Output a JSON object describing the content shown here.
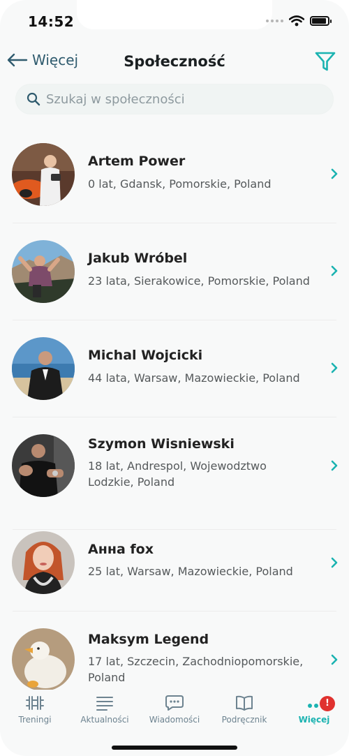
{
  "status_bar": {
    "time": "14:52"
  },
  "nav": {
    "back_label": "Więcej",
    "title": "Społeczność"
  },
  "search": {
    "placeholder": "Szukaj w społeczności",
    "value": ""
  },
  "colors": {
    "accent": "#1bb3b1",
    "badge": "#e0322f",
    "nav_text": "#2f5b6e"
  },
  "members": [
    {
      "name": "Artem Power",
      "meta": "0 lat, Gdansk, Pomorskie, Poland"
    },
    {
      "name": "Jakub Wróbel",
      "meta": "23 lata, Sierakowice, Pomorskie, Poland"
    },
    {
      "name": "Michal Wojcicki",
      "meta": "44 lata, Warsaw, Mazowieckie, Poland"
    },
    {
      "name": "Szymon Wisniewski",
      "meta": "18 lat, Andrespol, Wojewodztwo Lodzkie, Poland"
    },
    {
      "name": "Анна fox",
      "meta": "25 lat, Warsaw, Mazowieckie, Poland"
    },
    {
      "name": "Maksym Legend",
      "meta": "17 lat, Szczecin, Zachodniopomorskie, Poland"
    }
  ],
  "tabs": [
    {
      "label": "Treningi",
      "icon": "dumbbell-icon"
    },
    {
      "label": "Aktualności",
      "icon": "news-lines-icon"
    },
    {
      "label": "Wiadomości",
      "icon": "chat-bubble-icon"
    },
    {
      "label": "Podręcznik",
      "icon": "book-icon"
    },
    {
      "label": "Więcej",
      "icon": "more-dots-icon",
      "badge": "!",
      "active": true
    }
  ]
}
